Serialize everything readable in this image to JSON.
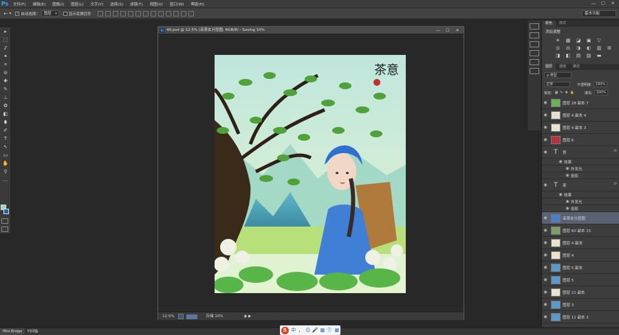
{
  "app": {
    "logo": "Ps",
    "menu": [
      "文件(F)",
      "编辑(E)",
      "图像(I)",
      "图层(L)",
      "文字(Y)",
      "选择(S)",
      "滤镜(T)",
      "视图(V)",
      "窗口(W)",
      "帮助(H)"
    ],
    "window_controls": [
      "—",
      "☐",
      "✕"
    ]
  },
  "options": {
    "auto_select_label": "自动选择：",
    "auto_select_value": "图层",
    "show_transform_label": "显示变换控件",
    "workspace": "基本功能"
  },
  "tools": [
    "▸",
    "⬚",
    "ᔑ",
    "✦",
    "⌗",
    "⊘",
    "✚",
    "✎",
    "⊥",
    "✿",
    "◧",
    "⬮",
    "✐",
    "T",
    "↖",
    "▭",
    "✋",
    "⚲",
    "…"
  ],
  "document": {
    "title": "49.psd @ 12.5% (采茶女分层图, RGB/8) - Saving 10%",
    "icon": "Ps",
    "buttons": [
      "—",
      "☐",
      "✕"
    ],
    "zoom": "12.5%",
    "status": "存储 10%",
    "artwork_title": "茶意",
    "seal_text": "印"
  },
  "panels": {
    "top_tabs": [
      "颜色",
      "样式"
    ],
    "adjust_title": "添加调整",
    "adjust_icons": [
      "☀",
      "▦",
      "◪",
      "▣",
      "▽",
      "◎",
      "⚖",
      "◑",
      "◐",
      "▥",
      "⊞",
      "◨",
      "◧",
      "▤",
      "▧",
      "▬",
      "▨"
    ],
    "layer_tabs": [
      "图层",
      "通道",
      "路径"
    ],
    "filter_label": "ρ 类型",
    "blend_mode": "正常",
    "opacity_label": "不透明度:",
    "opacity_value": "100%",
    "lock_label": "锁定:",
    "fill_label": "填充:",
    "fill_value": "100%",
    "layers": [
      {
        "name": "图层 28 副本 7"
      },
      {
        "name": "图层 4 副本 4"
      },
      {
        "name": "图层 4 副本 3"
      },
      {
        "name": "图层 6"
      },
      {
        "name": "意",
        "type": "text",
        "fx": "fx",
        "effects_label": "效果",
        "effects": [
          "外发光",
          "投影"
        ]
      },
      {
        "name": "茶",
        "type": "text",
        "fx": "fx",
        "effects_label": "效果",
        "effects": [
          "外发光",
          "投影"
        ]
      },
      {
        "name": "采茶女分层图",
        "selected": true
      },
      {
        "name": "图层 60 副本 15"
      },
      {
        "name": "图层 4 副本"
      },
      {
        "name": "图层 4"
      },
      {
        "name": "图层 5 副本"
      },
      {
        "name": "图层 5"
      },
      {
        "name": "图层 21 副本"
      },
      {
        "name": "图层 3"
      },
      {
        "name": "图层 11 副本 3"
      }
    ],
    "footer_icons": [
      "⚭",
      "fx",
      "◙",
      "◐",
      "▭",
      "⬒",
      "🗑"
    ]
  },
  "bottom": {
    "tabs": [
      "Mini Bridge",
      "时间轴"
    ],
    "ime": [
      "S",
      "中",
      "，",
      "☺",
      "🎤",
      "▦",
      "👕",
      "▦"
    ]
  }
}
